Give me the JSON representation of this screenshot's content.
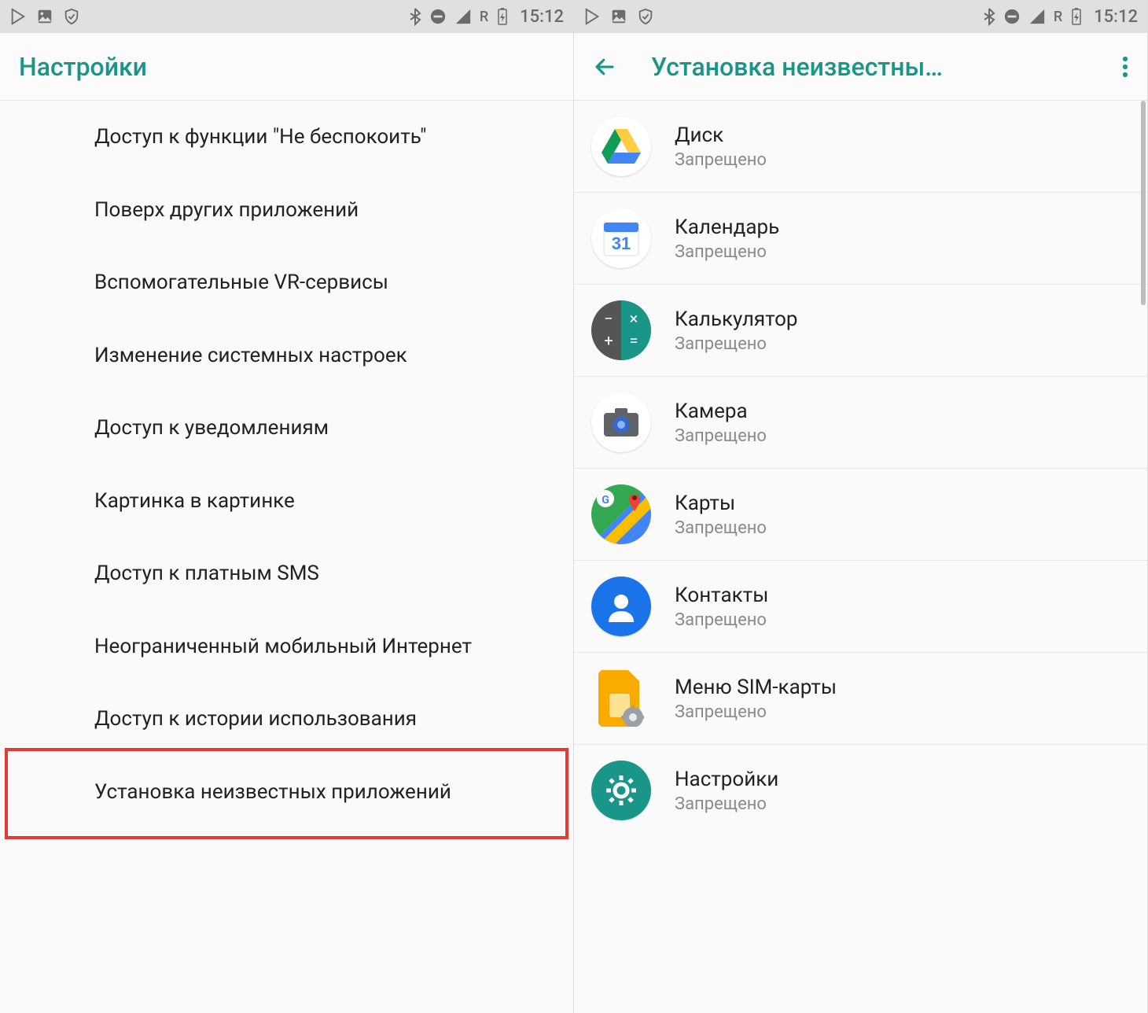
{
  "status_bar": {
    "time": "15:12",
    "net_label": "R"
  },
  "left_screen": {
    "title": "Настройки",
    "items": [
      "Доступ к функции \"Не беспокоить\"",
      "Поверх других приложений",
      "Вспомогательные VR-сервисы",
      "Изменение системных настроек",
      "Доступ к уведомлениям",
      "Картинка в картинке",
      "Доступ к платным SMS",
      "Неограниченный мобильный Интернет",
      "Доступ к истории использования",
      "Установка неизвестных приложений"
    ],
    "highlight_index": 9
  },
  "right_screen": {
    "title": "Установка неизвестны…",
    "status_denied": "Запрещено",
    "apps": [
      {
        "name": "Диск",
        "icon": "drive"
      },
      {
        "name": "Календарь",
        "icon": "calendar",
        "badge": "31"
      },
      {
        "name": "Калькулятор",
        "icon": "calculator"
      },
      {
        "name": "Камера",
        "icon": "camera"
      },
      {
        "name": "Карты",
        "icon": "maps"
      },
      {
        "name": "Контакты",
        "icon": "contacts"
      },
      {
        "name": "Меню SIM-карты",
        "icon": "sim"
      },
      {
        "name": "Настройки",
        "icon": "settings"
      }
    ]
  }
}
